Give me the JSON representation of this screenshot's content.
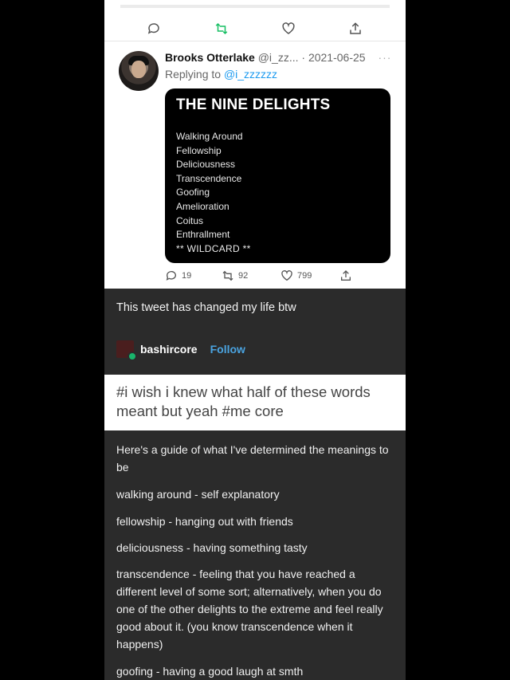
{
  "tweet": {
    "author_name": "Brooks Otterlake",
    "author_handle": "@i_zz...",
    "date": "· 2021-06-25",
    "more": "···",
    "replying_prefix": "Replying to",
    "replying_handle": "@i_zzzzzz",
    "card": {
      "title": "THE NINE DELIGHTS",
      "items": [
        "Walking Around",
        "Fellowship",
        "Deliciousness",
        "Transcendence",
        "Goofing",
        "Amelioration",
        "Coitus",
        "Enthrallment",
        "** WILDCARD **"
      ]
    },
    "stats": {
      "replies": "19",
      "retweets": "92",
      "likes": "799"
    }
  },
  "comment": {
    "text": "This tweet has changed my life btw",
    "username": "bashircore",
    "follow_label": "Follow"
  },
  "tags": {
    "text": "#i wish i knew what half of these words meant but yeah #me core"
  },
  "guide": {
    "paragraphs": [
      "Here's a guide of what I've determined the meanings to be",
      "walking around - self explanatory",
      "fellowship - hanging out with friends",
      "deliciousness - having something tasty",
      "transcendence - feeling that you have reached a different level of some sort; alternatively, when you do one of the other delights to the extreme and feel really good about it. (you know transcendence when it happens)",
      "goofing - having a good laugh at smth"
    ]
  },
  "icons": {
    "reply": "speech-bubble-icon",
    "retweet": "retweet-icon",
    "like": "heart-icon",
    "share": "share-icon"
  },
  "colors": {
    "link": "#1d9bf0",
    "follow": "#4aa3e0",
    "dark_bg": "#2b2b2b"
  }
}
